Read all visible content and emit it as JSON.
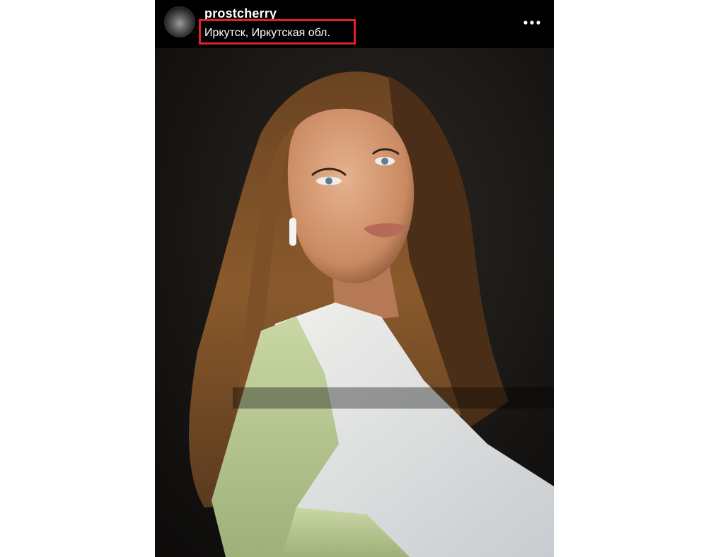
{
  "post": {
    "username": "prostcherry",
    "location": "Иркутск, Иркутская обл.",
    "more_icon": "more-horizontal-icon",
    "avatar_icon": "avatar",
    "highlight_color": "#e0202a"
  },
  "colors": {
    "header_bg": "#000000",
    "text": "#ffffff",
    "page_bg": "#ffffff"
  }
}
